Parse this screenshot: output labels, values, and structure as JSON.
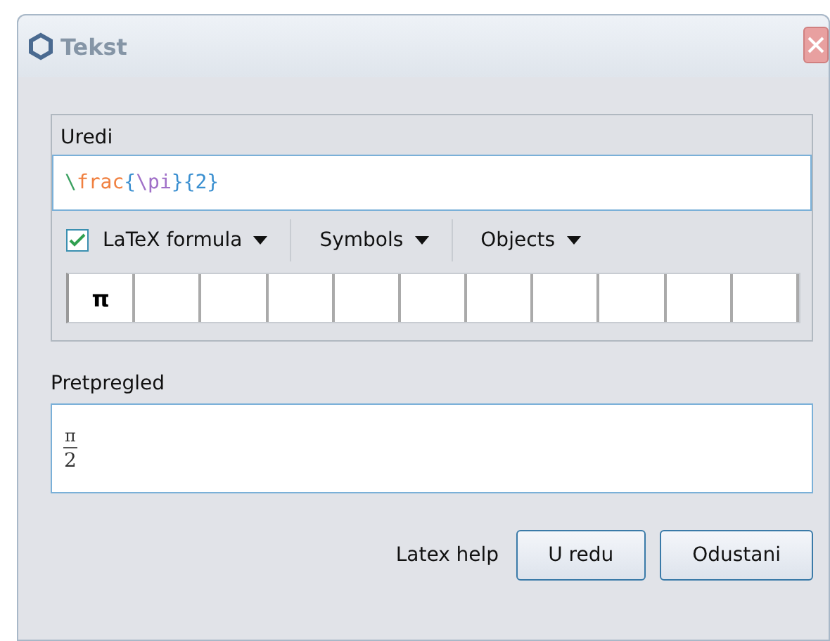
{
  "window": {
    "title": "Tekst"
  },
  "edit_panel": {
    "label": "Uredi",
    "formula_segments": [
      {
        "text": "\\",
        "color": "#3aa060"
      },
      {
        "text": "frac",
        "color": "#f08040"
      },
      {
        "text": "{",
        "color": "#3a8fd0"
      },
      {
        "text": "\\pi",
        "color": "#a070c8"
      },
      {
        "text": "}{2}",
        "color": "#3a8fd0"
      }
    ],
    "latex_checkbox": {
      "label": "LaTeX formula",
      "checked": true
    },
    "menus": [
      "Symbols",
      "Objects"
    ],
    "recent_symbols": [
      "π"
    ]
  },
  "preview": {
    "label": "Pretpregled",
    "numerator": "π",
    "denominator": "2"
  },
  "footer": {
    "help_label": "Latex help",
    "buttons": [
      "U redu",
      "Odustani"
    ]
  }
}
